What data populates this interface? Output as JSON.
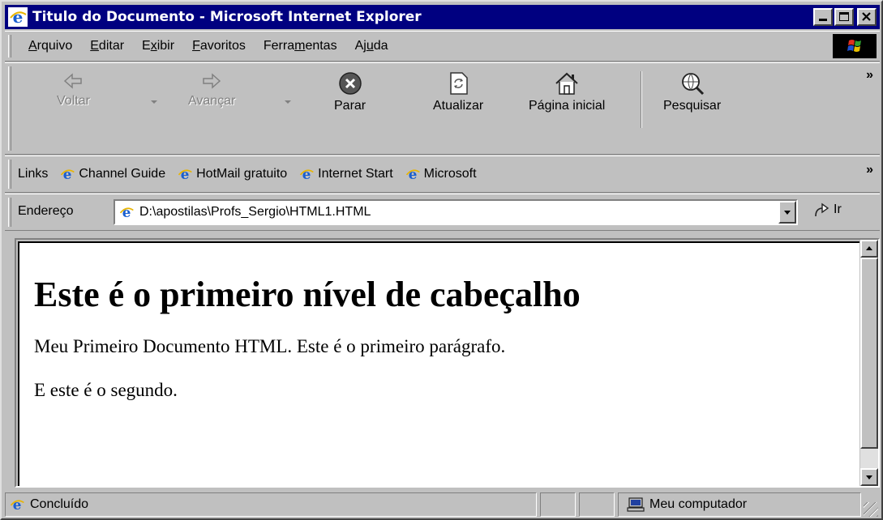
{
  "window": {
    "title": "Titulo do Documento - Microsoft Internet Explorer"
  },
  "menu": {
    "items": [
      {
        "label": "Arquivo",
        "accel_index": 0
      },
      {
        "label": "Editar",
        "accel_index": 0
      },
      {
        "label": "Exibir",
        "accel_index": 1
      },
      {
        "label": "Favoritos",
        "accel_index": 0
      },
      {
        "label": "Ferramentas",
        "accel_index": 5
      },
      {
        "label": "Ajuda",
        "accel_index": 2
      }
    ]
  },
  "toolbar": {
    "back_label": "Voltar",
    "forward_label": "Avançar",
    "stop_label": "Parar",
    "refresh_label": "Atualizar",
    "home_label": "Página inicial",
    "search_label": "Pesquisar",
    "more": "»"
  },
  "links": {
    "label": "Links",
    "items": [
      "Channel Guide",
      "HotMail gratuito",
      "Internet Start",
      "Microsoft"
    ],
    "more": "»"
  },
  "address": {
    "label": "Endereço",
    "value": "D:\\apostilas\\Profs_Sergio\\HTML1.HTML",
    "go_label": "Ir"
  },
  "page": {
    "heading": "Este é o primeiro nível de cabeçalho",
    "paragraphs": [
      "Meu Primeiro Documento HTML. Este é o primeiro parágrafo.",
      "E este é o segundo."
    ]
  },
  "status": {
    "text": "Concluído",
    "zone": "Meu computador"
  },
  "colors": {
    "titlebar": "#000080",
    "chrome": "#c0c0c0",
    "ie_icon": "#1a5fd0"
  }
}
